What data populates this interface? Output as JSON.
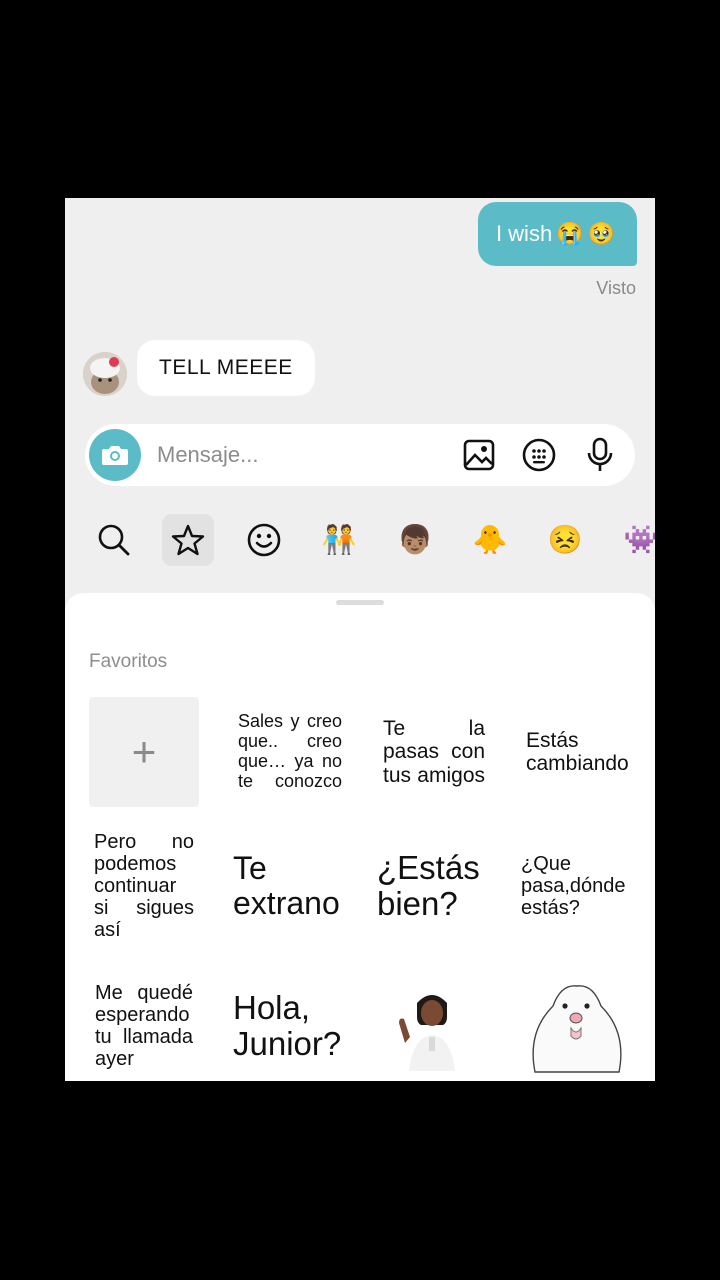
{
  "chat": {
    "sent_message": {
      "text": "I wish",
      "emojis": [
        "😭",
        "🥹"
      ],
      "status": "Visto"
    },
    "received_message": {
      "text": "TELL MEEEE"
    }
  },
  "composer": {
    "placeholder": "Mensaje...",
    "icons": [
      "camera-icon",
      "image-icon",
      "sticker-icon",
      "microphone-icon"
    ]
  },
  "sticker_tabs": [
    {
      "icon": "search-icon"
    },
    {
      "icon": "star-icon",
      "active": true
    },
    {
      "icon": "smiley-icon",
      "glyph": "☺"
    },
    {
      "icon": "avatar-pair-icon",
      "glyph": "🧑‍🤝‍🧑"
    },
    {
      "icon": "avatar-curly-icon",
      "glyph": "👦🏽"
    },
    {
      "icon": "chick-sticker-icon",
      "glyph": "🐥"
    },
    {
      "icon": "teal-face-icon",
      "glyph": "😣"
    },
    {
      "icon": "purple-monster-icon",
      "glyph": "👾"
    }
  ],
  "favorites": {
    "label": "Favoritos",
    "stickers": [
      {
        "text": "+"
      },
      {
        "text": "Sales y creo que.. creo que… ya no te conozco"
      },
      {
        "text": "Te la pasas con tus amigos"
      },
      {
        "text": "Estás cambiando"
      },
      {
        "text": "Pero no podemos continuar si sigues así"
      },
      {
        "text": "Te extrano"
      },
      {
        "text": "¿Estás bien?"
      },
      {
        "text": "¿Que pasa,dónde estás?"
      },
      {
        "text": "Me quedé esperando tu llamada ayer"
      },
      {
        "text": "Hola, Junior?"
      },
      {
        "text": "",
        "icon": "person-sticker"
      },
      {
        "text": "",
        "icon": "white-creature-sticker"
      }
    ]
  },
  "colors": {
    "accent": "#5bbcc8",
    "background": "#efefef",
    "panel": "#ffffff"
  }
}
